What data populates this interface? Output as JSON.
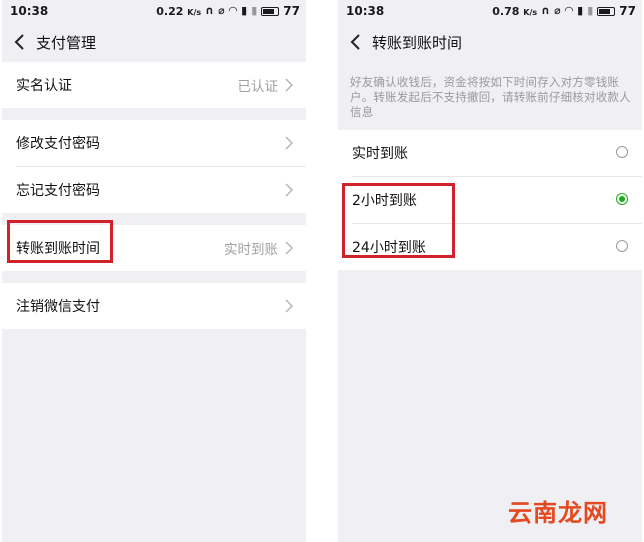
{
  "left": {
    "status": {
      "time": "10:38",
      "speed": "0.22",
      "speed_unit": "K/s",
      "battery": "77"
    },
    "nav_title": "支付管理",
    "items": [
      {
        "label": "实名认证",
        "value": "已认证"
      },
      {
        "label": "修改支付密码",
        "value": ""
      },
      {
        "label": "忘记支付密码",
        "value": ""
      },
      {
        "label": "转账到账时间",
        "value": "实时到账"
      },
      {
        "label": "注销微信支付",
        "value": ""
      }
    ]
  },
  "right": {
    "status": {
      "time": "10:38",
      "speed": "0.78",
      "speed_unit": "K/s",
      "battery": "77"
    },
    "nav_title": "转账到账时间",
    "notice": "好友确认收钱后，资金将按如下时间存入对方零钱账户。转账发起后不支持撤回，请转账前仔细核对收款人信息",
    "options": [
      {
        "label": "实时到账",
        "selected": false
      },
      {
        "label": "2小时到账",
        "selected": true
      },
      {
        "label": "24小时到账",
        "selected": false
      }
    ]
  },
  "accent_color": "#1aad19",
  "highlight_color": "#d1222b",
  "watermark": "云南龙网"
}
